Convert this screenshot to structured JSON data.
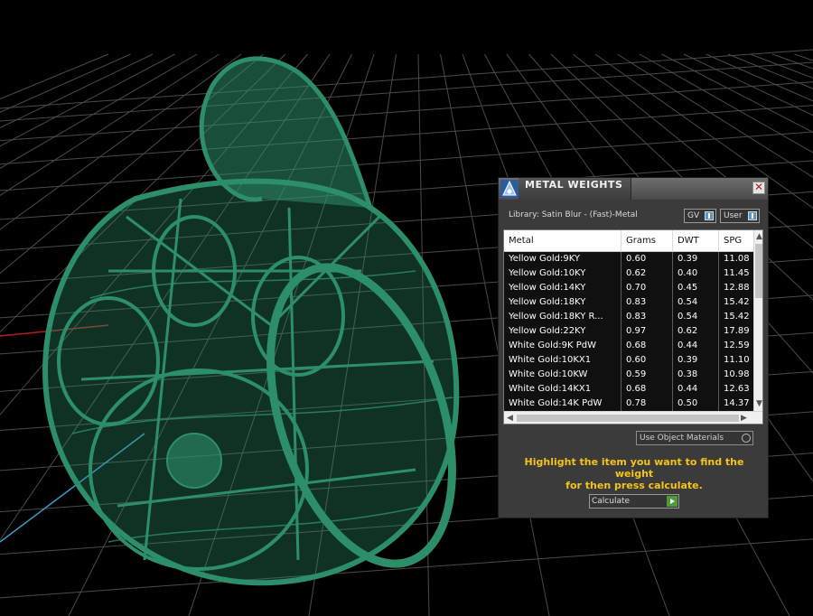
{
  "viewport": {
    "object": "green wireframe pendant model",
    "model_color": "#2d8f6a",
    "grid_color": "#4a4a4a",
    "x_axis_color": "#b02020",
    "y_axis_color": "#3a9fc8"
  },
  "panel": {
    "title": "METAL WEIGHTS",
    "app_icon": "app-logo-icon",
    "close_symbol": "✕",
    "library_label": "Library: Satin Blur - (Fast)-Metal",
    "toggles": [
      {
        "label": "GV",
        "state": "on"
      },
      {
        "label": "User",
        "state": "on"
      }
    ],
    "table": {
      "columns": [
        "Metal",
        "Grams",
        "DWT",
        "SPG"
      ],
      "rows": [
        [
          "Yellow Gold:9KY",
          "0.60",
          "0.39",
          "11.08"
        ],
        [
          "Yellow Gold:10KY",
          "0.62",
          "0.40",
          "11.45"
        ],
        [
          "Yellow Gold:14KY",
          "0.70",
          "0.45",
          "12.88"
        ],
        [
          "Yellow Gold:18KY",
          "0.83",
          "0.54",
          "15.42"
        ],
        [
          "Yellow Gold:18KY R...",
          "0.83",
          "0.54",
          "15.42"
        ],
        [
          "Yellow Gold:22KY",
          "0.97",
          "0.62",
          "17.89"
        ],
        [
          "White Gold:9K PdW",
          "0.68",
          "0.44",
          "12.59"
        ],
        [
          "White Gold:10KX1",
          "0.60",
          "0.39",
          "11.10"
        ],
        [
          "White Gold:10KW",
          "0.59",
          "0.38",
          "10.98"
        ],
        [
          "White Gold:14KX1",
          "0.68",
          "0.44",
          "12.63"
        ],
        [
          "White Gold:14K PdW",
          "0.78",
          "0.50",
          "14.37"
        ]
      ]
    },
    "use_object_materials_label": "Use Object Materials",
    "hint_line1": "Highlight the item you want to find the weight",
    "hint_line2": "for then press calculate.",
    "calculate_label": "Calculate",
    "accent_color": "#f5c418"
  }
}
